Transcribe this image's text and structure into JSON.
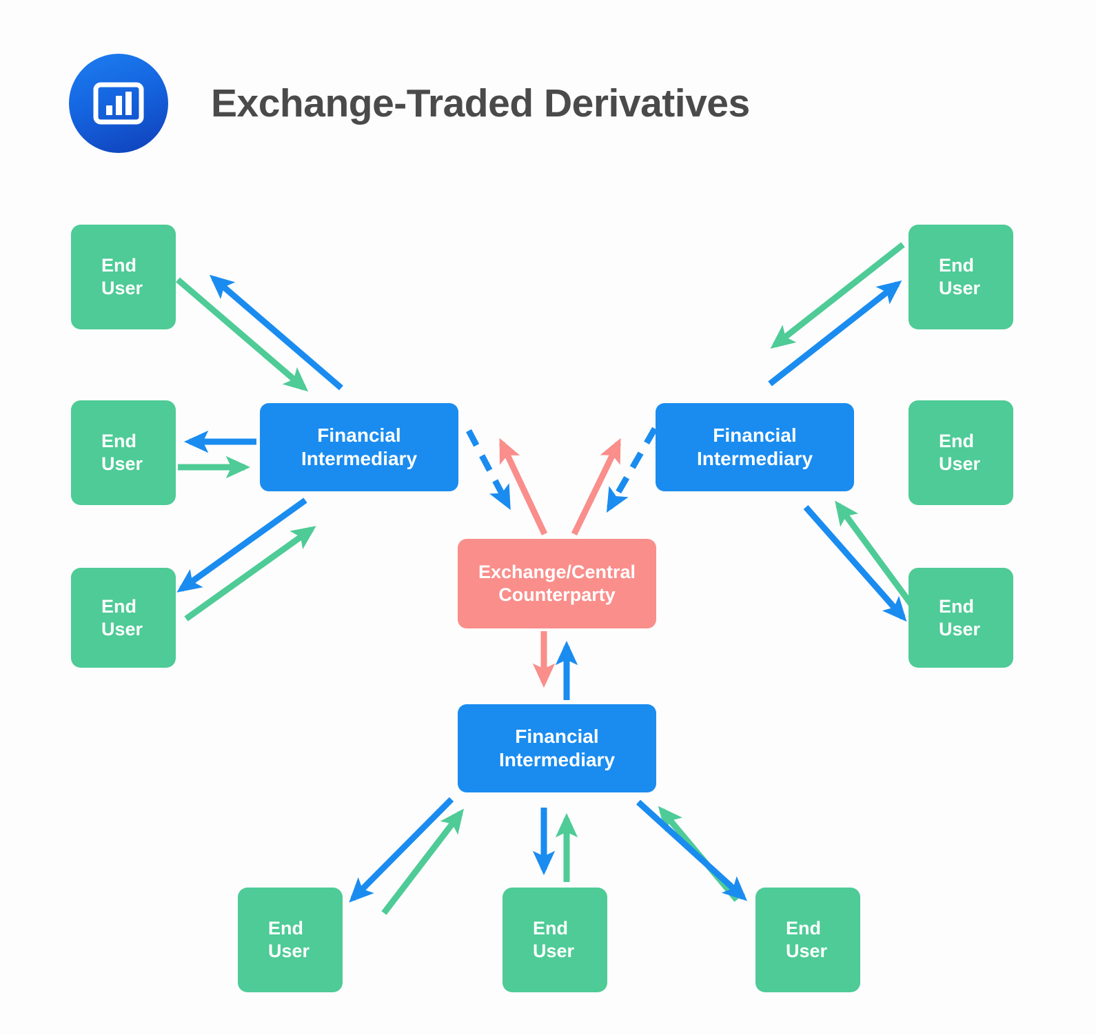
{
  "header": {
    "title": "Exchange-Traded Derivatives",
    "logo_icon": "bar-chart-icon",
    "logo_colors": {
      "gradient_from": "#1d7ef0",
      "gradient_to": "#0f3fb8"
    },
    "title_color": "#4a4a4a"
  },
  "theme": {
    "background": "#fdfdfd",
    "end_user_color": "#4ecb96",
    "intermediary_color": "#1a8cf0",
    "central_counterparty_color": "#f98e8b",
    "flow_to_intermediary_color": "#4ecb96",
    "flow_to_end_user_color": "#1a8cf0",
    "flow_clearing_color": "#f98e8b"
  },
  "diagram": {
    "type": "network-flow",
    "central_node": {
      "id": "ccp",
      "label": "Exchange/Central\nCounterparty",
      "line1": "Exchange/Central",
      "line2": "Counterparty",
      "kind": "central-counterparty"
    },
    "intermediaries": [
      {
        "id": "fi-left",
        "label": "Financial Intermediary",
        "line1": "Financial",
        "line2": "Intermediary",
        "position": "left"
      },
      {
        "id": "fi-right",
        "label": "Financial Intermediary",
        "line1": "Financial",
        "line2": "Intermediary",
        "position": "right"
      },
      {
        "id": "fi-bottom",
        "label": "Financial Intermediary",
        "line1": "Financial",
        "line2": "Intermediary",
        "position": "bottom"
      }
    ],
    "end_users": [
      {
        "id": "eu-l1",
        "label": "End User",
        "line1": "End",
        "line2": "User",
        "cluster": "left"
      },
      {
        "id": "eu-l2",
        "label": "End User",
        "line1": "End",
        "line2": "User",
        "cluster": "left"
      },
      {
        "id": "eu-l3",
        "label": "End User",
        "line1": "End",
        "line2": "User",
        "cluster": "left"
      },
      {
        "id": "eu-r1",
        "label": "End User",
        "line1": "End",
        "line2": "User",
        "cluster": "right"
      },
      {
        "id": "eu-r2",
        "label": "End User",
        "line1": "End",
        "line2": "User",
        "cluster": "right"
      },
      {
        "id": "eu-r3",
        "label": "End User",
        "line1": "End",
        "line2": "User",
        "cluster": "right"
      },
      {
        "id": "eu-b1",
        "label": "End User",
        "line1": "End",
        "line2": "User",
        "cluster": "bottom"
      },
      {
        "id": "eu-b2",
        "label": "End User",
        "line1": "End",
        "line2": "User",
        "cluster": "bottom"
      },
      {
        "id": "eu-b3",
        "label": "End User",
        "line1": "End",
        "line2": "User",
        "cluster": "bottom"
      }
    ],
    "flows": [
      {
        "from": "eu-l1",
        "to": "fi-left",
        "color": "#4ecb96",
        "style": "solid"
      },
      {
        "from": "fi-left",
        "to": "eu-l1",
        "color": "#1a8cf0",
        "style": "solid"
      },
      {
        "from": "eu-l2",
        "to": "fi-left",
        "color": "#4ecb96",
        "style": "solid"
      },
      {
        "from": "fi-left",
        "to": "eu-l2",
        "color": "#1a8cf0",
        "style": "solid"
      },
      {
        "from": "eu-l3",
        "to": "fi-left",
        "color": "#4ecb96",
        "style": "solid"
      },
      {
        "from": "fi-left",
        "to": "eu-l3",
        "color": "#1a8cf0",
        "style": "solid"
      },
      {
        "from": "eu-r1",
        "to": "fi-right",
        "color": "#4ecb96",
        "style": "solid"
      },
      {
        "from": "fi-right",
        "to": "eu-r1",
        "color": "#1a8cf0",
        "style": "solid"
      },
      {
        "from": "eu-r3",
        "to": "fi-right",
        "color": "#4ecb96",
        "style": "solid"
      },
      {
        "from": "fi-right",
        "to": "eu-r3",
        "color": "#1a8cf0",
        "style": "solid"
      },
      {
        "from": "eu-b1",
        "to": "fi-bottom",
        "color": "#4ecb96",
        "style": "solid"
      },
      {
        "from": "fi-bottom",
        "to": "eu-b1",
        "color": "#1a8cf0",
        "style": "solid"
      },
      {
        "from": "eu-b2",
        "to": "fi-bottom",
        "color": "#4ecb96",
        "style": "solid"
      },
      {
        "from": "fi-bottom",
        "to": "eu-b2",
        "color": "#1a8cf0",
        "style": "solid"
      },
      {
        "from": "eu-b3",
        "to": "fi-bottom",
        "color": "#4ecb96",
        "style": "solid"
      },
      {
        "from": "fi-bottom",
        "to": "eu-b3",
        "color": "#1a8cf0",
        "style": "solid"
      },
      {
        "from": "fi-left",
        "to": "ccp",
        "color": "#1a8cf0",
        "style": "dashed"
      },
      {
        "from": "ccp",
        "to": "fi-left",
        "color": "#f98e8b",
        "style": "solid"
      },
      {
        "from": "fi-right",
        "to": "ccp",
        "color": "#1a8cf0",
        "style": "dashed"
      },
      {
        "from": "ccp",
        "to": "fi-right",
        "color": "#f98e8b",
        "style": "solid"
      },
      {
        "from": "fi-bottom",
        "to": "ccp",
        "color": "#1a8cf0",
        "style": "solid"
      },
      {
        "from": "ccp",
        "to": "fi-bottom",
        "color": "#f98e8b",
        "style": "solid"
      }
    ]
  }
}
